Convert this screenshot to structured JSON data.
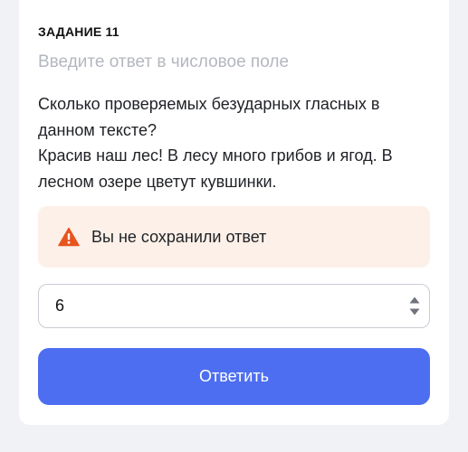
{
  "task": {
    "title": "ЗАДАНИЕ 11",
    "hint": "Введите ответ в числовое поле",
    "question_line1": "Сколько проверяемых безударных гласных в данном тексте?",
    "question_line2": "Красив наш лес! В лесу много грибов и ягод. В лесном озере цветут кувшинки."
  },
  "alert": {
    "icon": "warning-triangle-icon",
    "text": "Вы не сохранили ответ",
    "color": "#e8541e",
    "background": "#fdf0e8"
  },
  "answer": {
    "value": "6"
  },
  "submit": {
    "label": "Ответить",
    "color": "#4d6ef0"
  }
}
